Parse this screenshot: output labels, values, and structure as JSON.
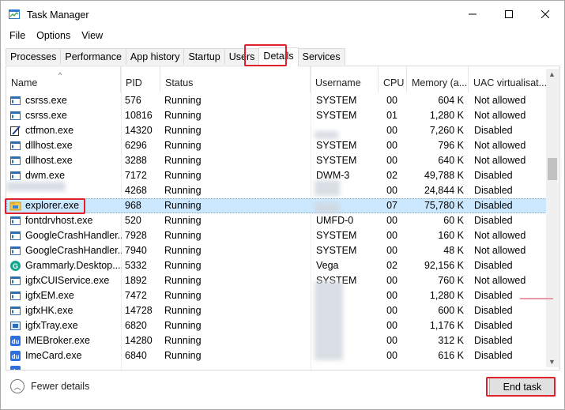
{
  "window": {
    "title": "Task Manager",
    "minimize_glyph": "—",
    "maximize_glyph": "☐",
    "close_glyph": "✕"
  },
  "menu": [
    {
      "label": "File"
    },
    {
      "label": "Options"
    },
    {
      "label": "View"
    }
  ],
  "tabs": [
    {
      "label": "Processes",
      "active": false
    },
    {
      "label": "Performance",
      "active": false
    },
    {
      "label": "App history",
      "active": false
    },
    {
      "label": "Startup",
      "active": false
    },
    {
      "label": "Users",
      "active": false
    },
    {
      "label": "Details",
      "active": true
    },
    {
      "label": "Services",
      "active": false
    }
  ],
  "columns": {
    "name": "Name",
    "pid": "PID",
    "status": "Status",
    "username": "Username",
    "cpu": "CPU",
    "memory": "Memory (a...",
    "uac": "UAC virtualisat..."
  },
  "sort_arrow": "^",
  "rows": [
    {
      "name": "csrss.exe",
      "pid": "576",
      "status": "Running",
      "username": "SYSTEM",
      "cpu": "00",
      "memory": "604 K",
      "uac": "Not allowed",
      "icon": "window-icon"
    },
    {
      "name": "csrss.exe",
      "pid": "10816",
      "status": "Running",
      "username": "SYSTEM",
      "cpu": "01",
      "memory": "1,280 K",
      "uac": "Not allowed",
      "icon": "window-icon"
    },
    {
      "name": "ctfmon.exe",
      "pid": "14320",
      "status": "Running",
      "username": "",
      "cpu": "00",
      "memory": "7,260 K",
      "uac": "Disabled",
      "icon": "pen-icon"
    },
    {
      "name": "dllhost.exe",
      "pid": "6296",
      "status": "Running",
      "username": "SYSTEM",
      "cpu": "00",
      "memory": "796 K",
      "uac": "Not allowed",
      "icon": "window-icon"
    },
    {
      "name": "dllhost.exe",
      "pid": "3288",
      "status": "Running",
      "username": "SYSTEM",
      "cpu": "00",
      "memory": "640 K",
      "uac": "Not allowed",
      "icon": "window-icon"
    },
    {
      "name": "dwm.exe",
      "pid": "7172",
      "status": "Running",
      "username": "DWM-3",
      "cpu": "02",
      "memory": "49,788 K",
      "uac": "Disabled",
      "icon": "window-icon"
    },
    {
      "name": "",
      "pid": "4268",
      "status": "Running",
      "username": "",
      "cpu": "00",
      "memory": "24,844 K",
      "uac": "Disabled",
      "icon": "blank"
    },
    {
      "name": "explorer.exe",
      "pid": "968",
      "status": "Running",
      "username": "",
      "cpu": "07",
      "memory": "75,780 K",
      "uac": "Disabled",
      "icon": "folder-icon",
      "selected": true
    },
    {
      "name": "fontdrvhost.exe",
      "pid": "520",
      "status": "Running",
      "username": "UMFD-0",
      "cpu": "00",
      "memory": "60 K",
      "uac": "Disabled",
      "icon": "window-icon"
    },
    {
      "name": "GoogleCrashHandler...",
      "pid": "7928",
      "status": "Running",
      "username": "SYSTEM",
      "cpu": "00",
      "memory": "160 K",
      "uac": "Not allowed",
      "icon": "window-icon"
    },
    {
      "name": "GoogleCrashHandler...",
      "pid": "7940",
      "status": "Running",
      "username": "SYSTEM",
      "cpu": "00",
      "memory": "48 K",
      "uac": "Not allowed",
      "icon": "window-icon"
    },
    {
      "name": "Grammarly.Desktop....",
      "pid": "5332",
      "status": "Running",
      "username": "Vega",
      "cpu": "02",
      "memory": "92,156 K",
      "uac": "Disabled",
      "icon": "grammarly-icon"
    },
    {
      "name": "igfxCUIService.exe",
      "pid": "1892",
      "status": "Running",
      "username": "SYSTEM",
      "cpu": "00",
      "memory": "760 K",
      "uac": "Not allowed",
      "icon": "window-icon"
    },
    {
      "name": "igfxEM.exe",
      "pid": "7472",
      "status": "Running",
      "username": "",
      "cpu": "00",
      "memory": "1,280 K",
      "uac": "Disabled",
      "icon": "window-icon"
    },
    {
      "name": "igfxHK.exe",
      "pid": "14728",
      "status": "Running",
      "username": "",
      "cpu": "00",
      "memory": "600 K",
      "uac": "Disabled",
      "icon": "window-icon"
    },
    {
      "name": "igfxTray.exe",
      "pid": "6820",
      "status": "Running",
      "username": "",
      "cpu": "00",
      "memory": "1,176 K",
      "uac": "Disabled",
      "icon": "tray-icon"
    },
    {
      "name": "IMEBroker.exe",
      "pid": "14280",
      "status": "Running",
      "username": "",
      "cpu": "00",
      "memory": "312 K",
      "uac": "Disabled",
      "icon": "du-icon"
    },
    {
      "name": "ImeCard.exe",
      "pid": "6840",
      "status": "Running",
      "username": "",
      "cpu": "00",
      "memory": "616 K",
      "uac": "Disabled",
      "icon": "du-icon"
    },
    {
      "name": "",
      "pid": "",
      "status": "",
      "username": "",
      "cpu": "",
      "memory": "",
      "uac": "",
      "icon": "du-icon"
    }
  ],
  "footer": {
    "fewer_details": "Fewer details",
    "fewer_glyph": "︿",
    "end_task": "End task"
  },
  "colors": {
    "highlight": "#e0202a",
    "selected_row": "#cce8ff"
  }
}
